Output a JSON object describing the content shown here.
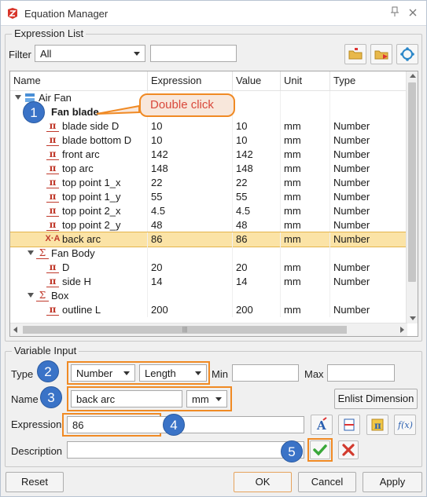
{
  "window": {
    "title": "Equation Manager",
    "pin_icon": "pin-icon",
    "close_icon": "close-icon"
  },
  "expression_list": {
    "group_title": "Expression List",
    "filter_label": "Filter",
    "filter_value": "All",
    "filter_text": "",
    "columns": [
      "Name",
      "Expression",
      "Value",
      "Unit",
      "Type"
    ],
    "rows": [
      {
        "level": 0,
        "kind": "part",
        "name": "Air Fan",
        "expression": "",
        "value": "",
        "unit": "",
        "type": "",
        "expanded": true
      },
      {
        "level": 1,
        "kind": "group",
        "name": "Fan blade",
        "expression": "",
        "value": "",
        "unit": "",
        "type": "",
        "bold": true
      },
      {
        "level": 2,
        "kind": "var",
        "name": "blade side D",
        "expression": "10",
        "value": "10",
        "unit": "mm",
        "type": "Number"
      },
      {
        "level": 2,
        "kind": "var",
        "name": "blade bottom D",
        "expression": "10",
        "value": "10",
        "unit": "mm",
        "type": "Number"
      },
      {
        "level": 2,
        "kind": "var",
        "name": "front arc",
        "expression": "142",
        "value": "142",
        "unit": "mm",
        "type": "Number"
      },
      {
        "level": 2,
        "kind": "var",
        "name": "top arc",
        "expression": "148",
        "value": "148",
        "unit": "mm",
        "type": "Number"
      },
      {
        "level": 2,
        "kind": "var",
        "name": "top point 1_x",
        "expression": "22",
        "value": "22",
        "unit": "mm",
        "type": "Number"
      },
      {
        "level": 2,
        "kind": "var",
        "name": "top point 1_y",
        "expression": "55",
        "value": "55",
        "unit": "mm",
        "type": "Number"
      },
      {
        "level": 2,
        "kind": "var",
        "name": "top point 2_x",
        "expression": "4.5",
        "value": "4.5",
        "unit": "mm",
        "type": "Number"
      },
      {
        "level": 2,
        "kind": "var",
        "name": "top point 2_y",
        "expression": "48",
        "value": "48",
        "unit": "mm",
        "type": "Number"
      },
      {
        "level": 2,
        "kind": "edit",
        "name": "back arc",
        "expression": "86",
        "value": "86",
        "unit": "mm",
        "type": "Number",
        "selected": true
      },
      {
        "level": 1,
        "kind": "sum",
        "name": "Fan Body",
        "expression": "",
        "value": "",
        "unit": "",
        "type": "",
        "expanded": true
      },
      {
        "level": 2,
        "kind": "var",
        "name": "D",
        "expression": "20",
        "value": "20",
        "unit": "mm",
        "type": "Number"
      },
      {
        "level": 2,
        "kind": "var",
        "name": "side H",
        "expression": "14",
        "value": "14",
        "unit": "mm",
        "type": "Number"
      },
      {
        "level": 1,
        "kind": "sum",
        "name": "Box",
        "expression": "",
        "value": "",
        "unit": "",
        "type": "",
        "expanded": true
      },
      {
        "level": 2,
        "kind": "var",
        "name": "outline L",
        "expression": "200",
        "value": "200",
        "unit": "mm",
        "type": "Number"
      }
    ]
  },
  "variable_input": {
    "group_title": "Variable Input",
    "type_label": "Type",
    "type_value": "Number",
    "unit_kind_value": "Length",
    "min_label": "Min",
    "max_label": "Max",
    "min_value": "",
    "max_value": "",
    "name_label": "Name",
    "name_value": "back arc",
    "unit_value": "mm",
    "enlist_button": "Enlist Dimension",
    "expression_label": "Expression",
    "expression_value": "86",
    "description_label": "Description",
    "description_value": ""
  },
  "annotations": {
    "bubble_text": "Double click",
    "steps": [
      "1",
      "2",
      "3",
      "4",
      "5"
    ]
  },
  "footer": {
    "reset": "Reset",
    "ok": "OK",
    "cancel": "Cancel",
    "apply": "Apply"
  },
  "colors": {
    "selection": "#fbe3a6",
    "accent_orange": "#f08a24",
    "callout_blue": "#3a73c7",
    "confirm_green": "#3aa83a",
    "cancel_red": "#d23a2e"
  }
}
